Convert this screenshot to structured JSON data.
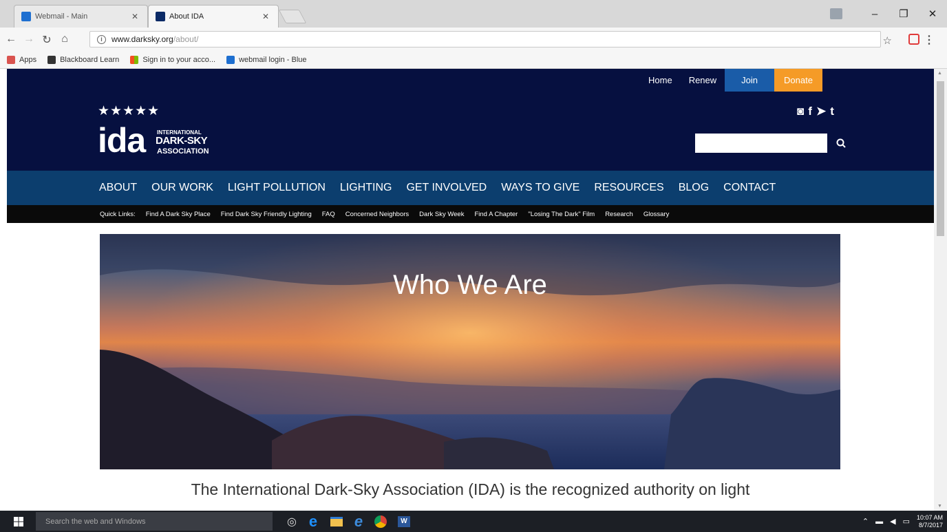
{
  "browser": {
    "tabs": [
      {
        "title": "Webmail - Main",
        "active": false,
        "favicon_color": "#1e6fd0"
      },
      {
        "title": "About IDA",
        "active": true,
        "favicon_color": "#0b2a66"
      }
    ],
    "url_host": "www.darksky.org",
    "url_path": "/about/",
    "bookmarks": [
      {
        "label": "Apps",
        "icon": "apps-grid-icon",
        "color": "#d9534f"
      },
      {
        "label": "Blackboard Learn",
        "icon": "blackboard-icon",
        "color": "#333333"
      },
      {
        "label": "Sign in to your acco...",
        "icon": "microsoft-icon",
        "color": "#f25022"
      },
      {
        "label": "webmail login - Blue",
        "icon": "webmail-icon",
        "color": "#1e6fd0"
      }
    ]
  },
  "site": {
    "topnav": {
      "home": "Home",
      "renew": "Renew",
      "join": "Join",
      "donate": "Donate"
    },
    "logo": {
      "stars": "★★★★★",
      "ida": "ida",
      "line1": "INTERNATIONAL",
      "line2": "DARK-SKY",
      "line3": "ASSOCIATION"
    },
    "social": [
      "instagram-icon",
      "facebook-icon",
      "twitter-icon",
      "tumblr-icon"
    ],
    "search_placeholder": "",
    "mainnav": [
      "ABOUT",
      "OUR WORK",
      "LIGHT POLLUTION",
      "LIGHTING",
      "GET INVOLVED",
      "WAYS TO GIVE",
      "RESOURCES",
      "BLOG",
      "CONTACT"
    ],
    "quicklinks": [
      "Quick Links:",
      "Find A Dark Sky Place",
      "Find Dark Sky Friendly Lighting",
      "FAQ",
      "Concerned Neighbors",
      "Dark Sky Week",
      "Find A Chapter",
      "\"Losing The Dark\" Film",
      "Research",
      "Glossary"
    ],
    "hero_title": "Who We Are",
    "intro_text": "The International Dark-Sky Association (IDA) is the recognized authority on light"
  },
  "taskbar": {
    "search_placeholder": "Search the web and Windows",
    "time": "10:07 AM",
    "date": "8/7/2017"
  },
  "colors": {
    "header_bg": "#061040",
    "mainnav_bg": "#0c3e6e",
    "join_bg": "#1a5ca8",
    "donate_bg": "#f59b27"
  }
}
